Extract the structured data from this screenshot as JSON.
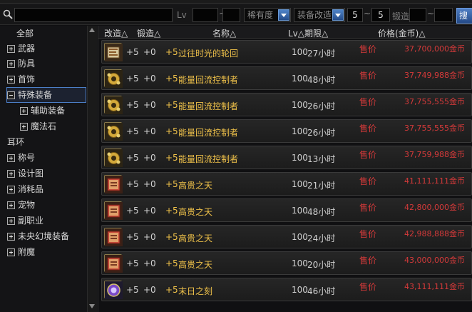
{
  "filter": {
    "search_placeholder": "",
    "lv_label": "Lv",
    "lv_min": "",
    "lv_max": "",
    "rarity_select": "稀有度",
    "enhance_select": "装备改造",
    "enhance_min": "5",
    "enhance_max": "5",
    "forge_label": "锻造",
    "forge_min": "",
    "forge_max": "",
    "search_button": "搜",
    "tilde": "~"
  },
  "sidebar": {
    "items": [
      {
        "label": "全部",
        "toggle": "none"
      },
      {
        "label": "武器",
        "toggle": "plus"
      },
      {
        "label": "防具",
        "toggle": "plus"
      },
      {
        "label": "首饰",
        "toggle": "plus"
      },
      {
        "label": "特殊装备",
        "toggle": "minus",
        "selected": true
      },
      {
        "label": "辅助装备",
        "toggle": "plus"
      },
      {
        "label": "魔法石",
        "toggle": "plus"
      },
      {
        "label": "耳环",
        "toggle": "none"
      },
      {
        "label": "称号",
        "toggle": "plus"
      },
      {
        "label": "设计图",
        "toggle": "plus"
      },
      {
        "label": "消耗品",
        "toggle": "plus"
      },
      {
        "label": "宠物",
        "toggle": "plus"
      },
      {
        "label": "副职业",
        "toggle": "plus"
      },
      {
        "label": "未央幻境装备",
        "toggle": "plus"
      },
      {
        "label": "附魔",
        "toggle": "plus"
      }
    ]
  },
  "table": {
    "headers": {
      "enhance": "改造△",
      "forge": "锻造△",
      "name": "名称△",
      "lv_period": "Lv△期限△",
      "price": "价格(金币)△"
    },
    "rows": [
      {
        "enhance": "+5",
        "forge": "+0",
        "name_prefix": "+5",
        "name": "过往时光的轮回",
        "lv": "100",
        "period": "27小时",
        "sell": "售价",
        "price": "37,700,000金币",
        "icon": "book-icon"
      },
      {
        "enhance": "+5",
        "forge": "+0",
        "name_prefix": "+5",
        "name": "能量回流控制者",
        "lv": "100",
        "period": "48小时",
        "sell": "售价",
        "price": "37,749,988金币",
        "icon": "gear-icon"
      },
      {
        "enhance": "+5",
        "forge": "+0",
        "name_prefix": "+5",
        "name": "能量回流控制者",
        "lv": "100",
        "period": "26小时",
        "sell": "售价",
        "price": "37,755,555金币",
        "icon": "gear-icon"
      },
      {
        "enhance": "+5",
        "forge": "+0",
        "name_prefix": "+5",
        "name": "能量回流控制者",
        "lv": "100",
        "period": "26小时",
        "sell": "售价",
        "price": "37,755,555金币",
        "icon": "gear-icon"
      },
      {
        "enhance": "+5",
        "forge": "+0",
        "name_prefix": "+5",
        "name": "能量回流控制者",
        "lv": "100",
        "period": "13小时",
        "sell": "售价",
        "price": "37,759,988金币",
        "icon": "gear-icon"
      },
      {
        "enhance": "+5",
        "forge": "+0",
        "name_prefix": "+5",
        "name": "高贵之天",
        "lv": "100",
        "period": "21小时",
        "sell": "售价",
        "price": "41,111,111金币",
        "icon": "tome-icon"
      },
      {
        "enhance": "+5",
        "forge": "+0",
        "name_prefix": "+5",
        "name": "高贵之天",
        "lv": "100",
        "period": "48小时",
        "sell": "售价",
        "price": "42,800,000金币",
        "icon": "tome-icon"
      },
      {
        "enhance": "+5",
        "forge": "+0",
        "name_prefix": "+5",
        "name": "高贵之天",
        "lv": "100",
        "period": "24小时",
        "sell": "售价",
        "price": "42,988,888金币",
        "icon": "tome-icon"
      },
      {
        "enhance": "+5",
        "forge": "+0",
        "name_prefix": "+5",
        "name": "高贵之天",
        "lv": "100",
        "period": "20小时",
        "sell": "售价",
        "price": "43,000,000金币",
        "icon": "tome-icon"
      },
      {
        "enhance": "+5",
        "forge": "+0",
        "name_prefix": "+5",
        "name": "末日之刻",
        "lv": "100",
        "period": "46小时",
        "sell": "售价",
        "price": "43,111,111金币",
        "icon": "orb-icon"
      }
    ]
  },
  "colors": {
    "item_name": "#f0c24a",
    "price": "#d63a3a",
    "accent": "#4c7fc8"
  }
}
